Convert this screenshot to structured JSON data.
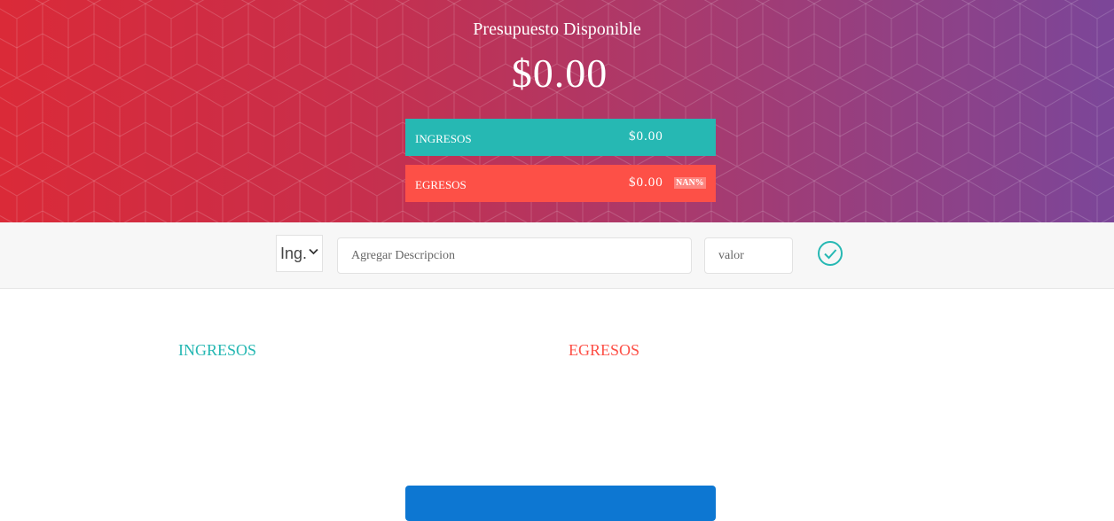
{
  "header": {
    "title": "Presupuesto Disponible",
    "budget": "$0.00",
    "colors": {
      "gradient_start": "#da2a38",
      "gradient_end": "#7b4699"
    }
  },
  "summary": {
    "income": {
      "label": "Ingresos",
      "amount": "$0.00",
      "color": "#26b8b3"
    },
    "expense": {
      "label": "Egresos",
      "amount": "$0.00",
      "percentage": "NAN%",
      "color": "#fd5047"
    }
  },
  "form": {
    "type_select": {
      "selected": "Ing.",
      "icon": "chevron-down-icon"
    },
    "description": {
      "placeholder": "Agregar Descripcion",
      "value": ""
    },
    "value": {
      "placeholder": "valor",
      "value": ""
    },
    "submit_icon": "check-circle-icon"
  },
  "lists": {
    "income_title": "Ingresos",
    "expense_title": "Egresos"
  },
  "footer": {
    "block_color": "#0d77d2"
  }
}
